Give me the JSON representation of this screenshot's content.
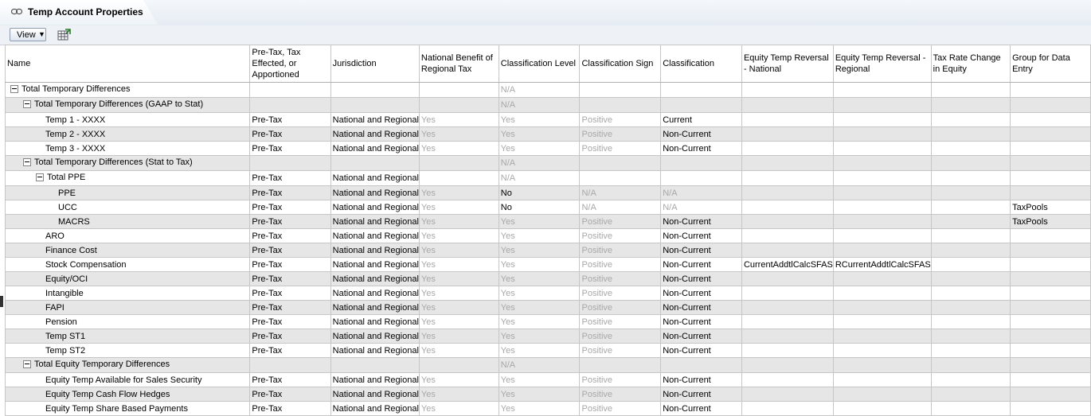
{
  "tab": {
    "title": "Temp Account Properties",
    "icon": "link-icon"
  },
  "toolbar": {
    "view_label": "View",
    "detach_icon": "detach-grid-icon"
  },
  "columns": [
    "Name",
    "Pre-Tax, Tax Effected, or Apportioned",
    "Jurisdiction",
    "National Benefit of Regional Tax",
    "Classification Level",
    "Classification Sign",
    "Classification",
    "Equity Temp Reversal - National",
    "Equity Temp Reversal - Regional",
    "Tax Rate Change in Equity",
    "Group for Data Entry"
  ],
  "rows": [
    {
      "name": "Total Temporary Differences",
      "level": 0,
      "expand": true,
      "cells": [
        "",
        "",
        "",
        "N/A",
        "",
        "",
        "",
        "",
        "",
        ""
      ],
      "grey": [
        4
      ]
    },
    {
      "name": "Total Temporary Differences (GAAP to Stat)",
      "level": 1,
      "expand": true,
      "cells": [
        "",
        "",
        "",
        "N/A",
        "",
        "",
        "",
        "",
        "",
        ""
      ],
      "grey": [
        4
      ]
    },
    {
      "name": "Temp 1 - XXXX",
      "level": 3,
      "cells": [
        "Pre-Tax",
        "National and Regional",
        "Yes",
        "Yes",
        "Positive",
        "Current",
        "",
        "",
        "",
        ""
      ],
      "grey": [
        3,
        4,
        5
      ]
    },
    {
      "name": "Temp 2 - XXXX",
      "level": 3,
      "cells": [
        "Pre-Tax",
        "National and Regional",
        "Yes",
        "Yes",
        "Positive",
        "Non-Current",
        "",
        "",
        "",
        ""
      ],
      "grey": [
        3,
        4,
        5
      ]
    },
    {
      "name": "Temp 3 - XXXX",
      "level": 3,
      "cells": [
        "Pre-Tax",
        "National and Regional",
        "Yes",
        "Yes",
        "Positive",
        "Non-Current",
        "",
        "",
        "",
        ""
      ],
      "grey": [
        3,
        4,
        5
      ]
    },
    {
      "name": "Total Temporary Differences (Stat to Tax)",
      "level": 1,
      "expand": true,
      "cells": [
        "",
        "",
        "",
        "N/A",
        "",
        "",
        "",
        "",
        "",
        ""
      ],
      "grey": [
        4
      ]
    },
    {
      "name": "Total PPE",
      "level": 2,
      "expand": true,
      "cells": [
        "Pre-Tax",
        "National and Regional",
        "",
        "N/A",
        "",
        "",
        "",
        "",
        "",
        ""
      ],
      "grey": [
        4
      ]
    },
    {
      "name": "PPE",
      "level": 4,
      "cells": [
        "Pre-Tax",
        "National and Regional",
        "Yes",
        "No",
        "N/A",
        "N/A",
        "",
        "",
        "",
        ""
      ],
      "grey": [
        3,
        5,
        6
      ]
    },
    {
      "name": "UCC",
      "level": 4,
      "cells": [
        "Pre-Tax",
        "National and Regional",
        "Yes",
        "No",
        "N/A",
        "N/A",
        "",
        "",
        "",
        "TaxPools"
      ],
      "grey": [
        3,
        5,
        6
      ]
    },
    {
      "name": "MACRS",
      "level": 4,
      "cells": [
        "Pre-Tax",
        "National and Regional",
        "Yes",
        "Yes",
        "Positive",
        "Non-Current",
        "",
        "",
        "",
        "TaxPools"
      ],
      "grey": [
        3,
        4,
        5
      ]
    },
    {
      "name": "ARO",
      "level": 3,
      "cells": [
        "Pre-Tax",
        "National and Regional",
        "Yes",
        "Yes",
        "Positive",
        "Non-Current",
        "",
        "",
        "",
        ""
      ],
      "grey": [
        3,
        4,
        5
      ]
    },
    {
      "name": "Finance Cost",
      "level": 3,
      "cells": [
        "Pre-Tax",
        "National and Regional",
        "Yes",
        "Yes",
        "Positive",
        "Non-Current",
        "",
        "",
        "",
        ""
      ],
      "grey": [
        3,
        4,
        5
      ]
    },
    {
      "name": "Stock Compensation",
      "level": 3,
      "cells": [
        "Pre-Tax",
        "National and Regional",
        "Yes",
        "Yes",
        "Positive",
        "Non-Current",
        "CurrentAddtlCalcSFAS",
        "RCurrentAddtlCalcSFAS",
        "",
        ""
      ],
      "grey": [
        3,
        4,
        5
      ]
    },
    {
      "name": "Equity/OCI",
      "level": 3,
      "cells": [
        "Pre-Tax",
        "National and Regional",
        "Yes",
        "Yes",
        "Positive",
        "Non-Current",
        "",
        "",
        "",
        ""
      ],
      "grey": [
        3,
        4,
        5
      ]
    },
    {
      "name": "Intangible",
      "level": 3,
      "cells": [
        "Pre-Tax",
        "National and Regional",
        "Yes",
        "Yes",
        "Positive",
        "Non-Current",
        "",
        "",
        "",
        ""
      ],
      "grey": [
        3,
        4,
        5
      ]
    },
    {
      "name": "FAPI",
      "level": 3,
      "cells": [
        "Pre-Tax",
        "National and Regional",
        "Yes",
        "Yes",
        "Positive",
        "Non-Current",
        "",
        "",
        "",
        ""
      ],
      "grey": [
        3,
        4,
        5
      ]
    },
    {
      "name": "Pension",
      "level": 3,
      "cells": [
        "Pre-Tax",
        "National and Regional",
        "Yes",
        "Yes",
        "Positive",
        "Non-Current",
        "",
        "",
        "",
        ""
      ],
      "grey": [
        3,
        4,
        5
      ]
    },
    {
      "name": "Temp ST1",
      "level": 3,
      "cells": [
        "Pre-Tax",
        "National and Regional",
        "Yes",
        "Yes",
        "Positive",
        "Non-Current",
        "",
        "",
        "",
        ""
      ],
      "grey": [
        3,
        4,
        5
      ]
    },
    {
      "name": "Temp ST2",
      "level": 3,
      "cells": [
        "Pre-Tax",
        "National and Regional",
        "Yes",
        "Yes",
        "Positive",
        "Non-Current",
        "",
        "",
        "",
        ""
      ],
      "grey": [
        3,
        4,
        5
      ]
    },
    {
      "name": "Total Equity Temporary Differences",
      "level": 1,
      "expand": true,
      "cells": [
        "",
        "",
        "",
        "N/A",
        "",
        "",
        "",
        "",
        "",
        ""
      ],
      "grey": [
        4
      ]
    },
    {
      "name": "Equity Temp Available for Sales Security",
      "level": 3,
      "cells": [
        "Pre-Tax",
        "National and Regional",
        "Yes",
        "Yes",
        "Positive",
        "Non-Current",
        "",
        "",
        "",
        ""
      ],
      "grey": [
        3,
        4,
        5
      ]
    },
    {
      "name": "Equity Temp Cash Flow Hedges",
      "level": 3,
      "cells": [
        "Pre-Tax",
        "National and Regional",
        "Yes",
        "Yes",
        "Positive",
        "Non-Current",
        "",
        "",
        "",
        ""
      ],
      "grey": [
        3,
        4,
        5
      ]
    },
    {
      "name": "Equity Temp Share Based Payments",
      "level": 3,
      "cells": [
        "Pre-Tax",
        "National and Regional",
        "Yes",
        "Yes",
        "Positive",
        "Non-Current",
        "",
        "",
        "",
        ""
      ],
      "grey": [
        3,
        4,
        5
      ]
    }
  ]
}
